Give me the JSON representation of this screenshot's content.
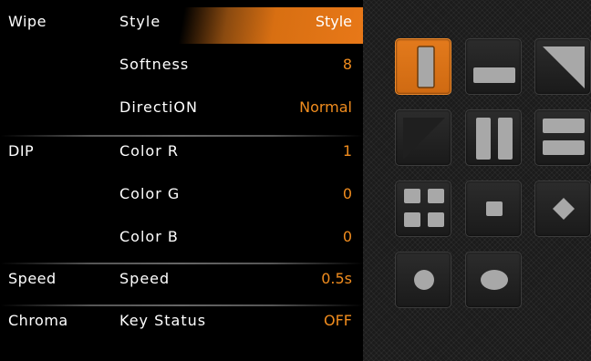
{
  "menu": {
    "rows": [
      {
        "category": "Wipe",
        "label": "Style",
        "value": "Style"
      },
      {
        "category": "",
        "label": "Softness",
        "value": "8"
      },
      {
        "category": "",
        "label": "DirectiON",
        "value": "Normal"
      },
      {
        "category": "DIP",
        "label": "Color R",
        "value": "1"
      },
      {
        "category": "",
        "label": "Color G",
        "value": "0"
      },
      {
        "category": "",
        "label": "Color B",
        "value": "0"
      },
      {
        "category": "Speed",
        "label": "Speed",
        "value": "0.5s"
      },
      {
        "category": "Chroma",
        "label": "Key Status",
        "value": "OFF"
      }
    ],
    "selected_row": "Style"
  },
  "wipe_styles": {
    "selected": "vertical-bar",
    "items": [
      "vertical-bar-icon",
      "horizontal-bar-icon",
      "diagonal-top-right-icon",
      "diagonal-bottom-left-icon",
      "split-vertical-icon",
      "split-horizontal-icon",
      "four-squares-icon",
      "center-square-icon",
      "diamond-icon",
      "circle-icon",
      "ellipse-icon"
    ]
  },
  "colors": {
    "accent": "#e87818",
    "value_text": "#f08c1e",
    "label_text": "#ffffff",
    "shape_fill": "#a8a8a8"
  }
}
